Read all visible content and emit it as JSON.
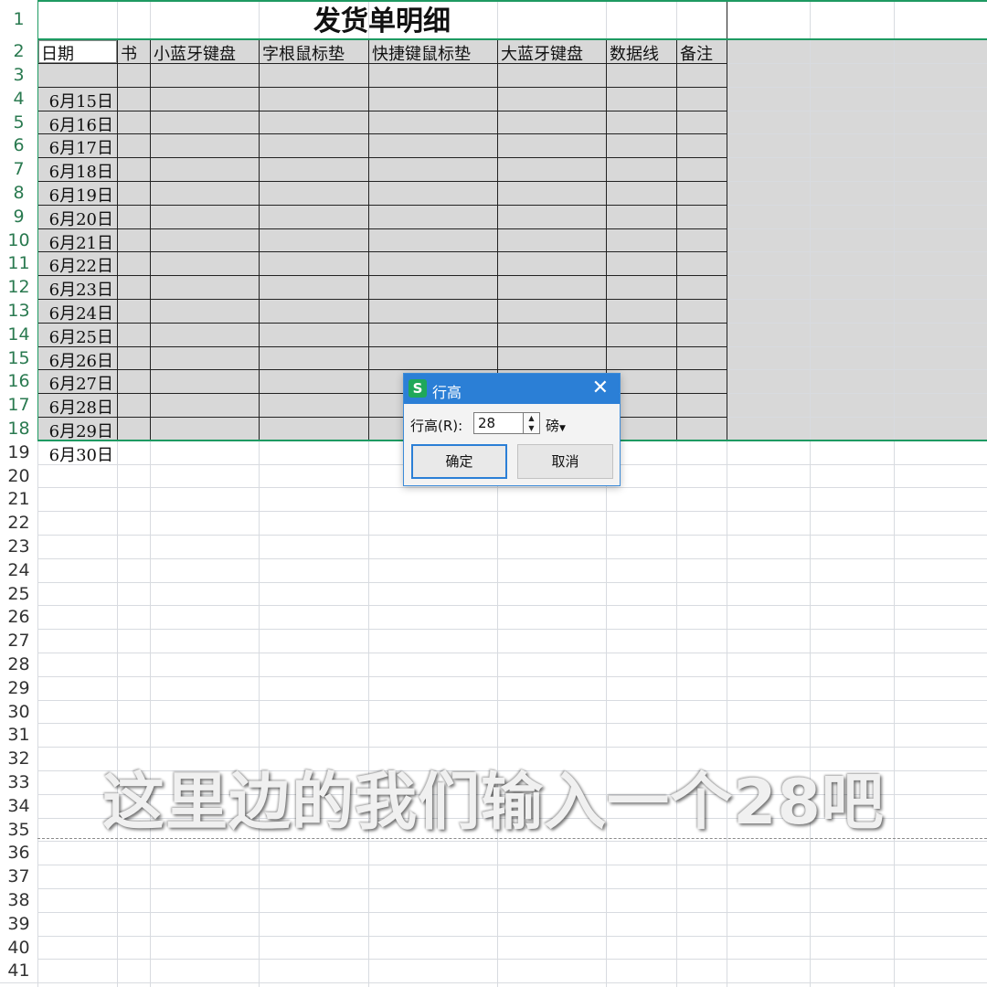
{
  "sheet": {
    "title": "发货单明细",
    "headers": [
      "日期",
      "书",
      "小蓝牙键盘",
      "字根鼠标垫",
      "快捷键鼠标垫",
      "大蓝牙键盘",
      "数据线",
      "备注"
    ],
    "dates": [
      "6月15日",
      "6月16日",
      "6月17日",
      "6月18日",
      "6月19日",
      "6月20日",
      "6月21日",
      "6月22日",
      "6月23日",
      "6月24日",
      "6月25日",
      "6月26日",
      "6月27日",
      "6月28日",
      "6月29日",
      "6月30日"
    ],
    "row_numbers": [
      "1",
      "2",
      "3",
      "4",
      "5",
      "6",
      "7",
      "8",
      "9",
      "10",
      "11",
      "12",
      "13",
      "14",
      "15",
      "16",
      "17",
      "18",
      "19",
      "20",
      "21",
      "22",
      "23",
      "24",
      "25",
      "26",
      "27",
      "28",
      "29",
      "30",
      "31",
      "32",
      "33",
      "34",
      "35",
      "36",
      "37",
      "38",
      "39",
      "40",
      "41"
    ]
  },
  "dialog": {
    "logo": "S",
    "title": "行高",
    "label": "行高(R):",
    "value": "28",
    "unit": "磅",
    "ok_label": "确定",
    "cancel_label": "取消",
    "close_icon": "close-icon",
    "accent": "#2b7fd6"
  },
  "subtitle": "这里边的我们输入一个28吧",
  "colors": {
    "selection": "#d8d8d8",
    "selection_border": "#1e9a62",
    "row_header_selected": "#2a7a50"
  }
}
